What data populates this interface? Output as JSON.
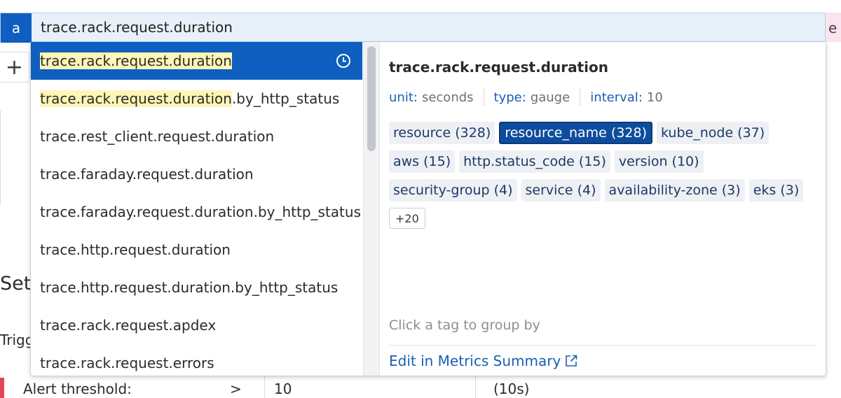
{
  "query": {
    "badge": "a",
    "value": "trace.rack.request.duration"
  },
  "background": {
    "plus_glyph": "+",
    "section_heading": "Set",
    "trigger_label": "Trigg",
    "right_tag": "e",
    "alert": {
      "label": "Alert threshold:",
      "operator": ">",
      "value": "10",
      "unit": "(10s)"
    }
  },
  "suggestions": [
    {
      "match": "trace.rack.request.duration",
      "rest": "",
      "selected": true
    },
    {
      "match": "trace.rack.request.duration",
      "rest": ".by_http_status",
      "selected": false
    },
    {
      "match": "",
      "rest": "trace.rest_client.request.duration",
      "selected": false
    },
    {
      "match": "",
      "rest": "trace.faraday.request.duration",
      "selected": false
    },
    {
      "match": "",
      "rest": "trace.faraday.request.duration.by_http_status",
      "selected": false
    },
    {
      "match": "",
      "rest": "trace.http.request.duration",
      "selected": false
    },
    {
      "match": "",
      "rest": "trace.http.request.duration.by_http_status",
      "selected": false
    },
    {
      "match": "",
      "rest": "trace.rack.request.apdex",
      "selected": false
    },
    {
      "match": "",
      "rest": "trace.rack.request.errors",
      "selected": false
    }
  ],
  "detail": {
    "title": "trace.rack.request.duration",
    "meta": [
      {
        "key": "unit:",
        "value": "seconds"
      },
      {
        "key": "type:",
        "value": "gauge"
      },
      {
        "key": "interval:",
        "value": "10"
      }
    ],
    "tag_rows": [
      [
        {
          "label": "resource (328)",
          "active": false
        },
        {
          "label": "resource_name (328)",
          "active": true
        },
        {
          "label": "kube_node (37)",
          "active": false
        }
      ],
      [
        {
          "label": "aws (15)",
          "active": false
        },
        {
          "label": "http.status_code (15)",
          "active": false
        },
        {
          "label": "version (10)",
          "active": false
        }
      ],
      [
        {
          "label": "security-group (4)",
          "active": false
        },
        {
          "label": "service (4)",
          "active": false
        },
        {
          "label": "availability-zone (3)",
          "active": false
        },
        {
          "label": "eks (3)",
          "active": false
        }
      ]
    ],
    "more_label": "+20",
    "hint": "Click a tag to group by",
    "edit_link": "Edit in Metrics Summary"
  },
  "icons": {
    "selected_row": "clock-icon",
    "edit_link": "external-link-icon"
  },
  "colors": {
    "accent": "#0e5fbf",
    "highlight": "#fdf6b6",
    "link": "#1a5fb4",
    "active_tag": "#0e4d9e",
    "alert": "#e5455b"
  }
}
